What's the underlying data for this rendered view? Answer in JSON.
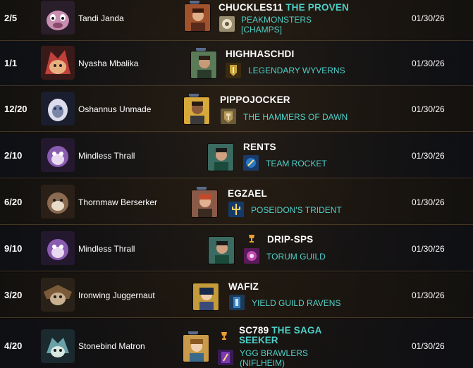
{
  "rows": [
    {
      "count": "2/5",
      "card": "Tandi Janda",
      "player": "CHUCKLES11",
      "player_title": "THE PROVEN",
      "guild_line1": "PEAKMONSTERS",
      "guild_line2": "[CHAMPS]",
      "date": "01/30/26",
      "card_color": "#c98fb2",
      "avatar_color": "#a0522d",
      "guild_color": "#9a8e70",
      "guild_icon": "guild-emblem-icon"
    },
    {
      "count": "1/1",
      "card": "Nyasha Mbalika",
      "player": "HIGHHASCHDI",
      "guild_line1": "LEGENDARY WYVERNS",
      "date": "01/30/26",
      "card_color": "#c0403a",
      "avatar_color": "#5a7a58",
      "guild_color": "#c9a23a",
      "guild_icon": "guild-emblem-icon"
    },
    {
      "count": "12/20",
      "card": "Oshannus Unmade",
      "player": "PIPPOJOCKER",
      "guild_line1": "THE HAMMERS OF DAWN",
      "date": "01/30/26",
      "card_color": "#7a86a8",
      "avatar_color": "#d6a93a",
      "guild_color": "#b89a56",
      "guild_icon": "guild-emblem-icon"
    },
    {
      "count": "2/10",
      "card": "Mindless Thrall",
      "player": "RENTS",
      "guild_line1": "TEAM ROCKET",
      "date": "01/30/26",
      "card_color": "#8a5cb0",
      "avatar_color": "#3a6a60",
      "guild_color": "#2a78c4",
      "guild_icon": "guild-emblem-icon"
    },
    {
      "count": "6/20",
      "card": "Thornmaw Berserker",
      "player": "EGZAEL",
      "guild_line1": "POSEIDON'S TRIDENT",
      "date": "01/30/26",
      "card_color": "#8a6a50",
      "avatar_color": "#8a5a48",
      "guild_color": "#2a70c0",
      "guild_icon": "guild-emblem-icon"
    },
    {
      "count": "9/10",
      "card": "Mindless Thrall",
      "player": "DRIP-SPS",
      "guild_line1": "TORUM GUILD",
      "date": "01/30/26",
      "card_color": "#8a5cb0",
      "avatar_color": "#3a6a60",
      "guild_color": "#c04ab0",
      "guild_icon": "guild-emblem-icon"
    },
    {
      "count": "3/20",
      "card": "Ironwing Juggernaut",
      "player": "WAFIZ",
      "guild_line1": "YIELD GUILD RAVENS",
      "date": "01/30/26",
      "card_color": "#7a5a38",
      "avatar_color": "#c49a3a",
      "guild_color": "#3a80c0",
      "guild_icon": "guild-emblem-icon"
    },
    {
      "count": "4/20",
      "card": "Stonebind Matron",
      "player": "SC789",
      "player_title": "THE SAGA",
      "player_title_line2": "SEEKER",
      "guild_line1": "YGG BRAWLERS",
      "guild_line2": "(NIFLHEIM)",
      "date": "01/30/26",
      "card_color": "#6aa0a8",
      "avatar_color": "#c89a4a",
      "guild_color": "#7a3ab0",
      "guild_icon": "guild-emblem-icon"
    }
  ]
}
